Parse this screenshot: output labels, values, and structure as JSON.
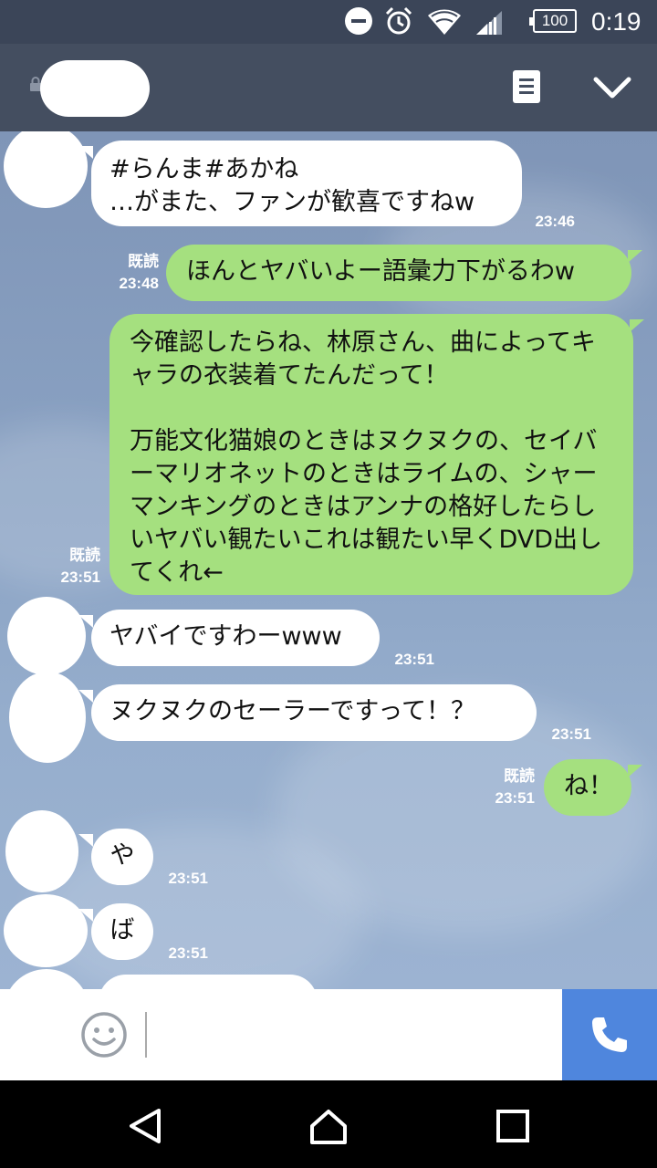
{
  "status_bar": {
    "battery": "100",
    "time": "0:19",
    "icons": [
      "do-not-disturb-icon",
      "alarm-icon",
      "wifi-icon",
      "signal-icon",
      "battery-icon"
    ]
  },
  "header": {
    "icons": [
      "lock-icon",
      "menu-icon",
      "chevron-down-icon"
    ]
  },
  "messages": [
    {
      "type": "received",
      "text": "#らんま#あかね\n…がまた、ファンが歓喜ですねw",
      "time": "23:46"
    },
    {
      "type": "sent",
      "read": "既読",
      "text": "ほんとヤバいよー語彙力下がるわw",
      "time": "23:48"
    },
    {
      "type": "sent",
      "read": "既読",
      "text": "今確認したらね、林原さん、曲によってキャラの衣装着てたんだって！\n\n万能文化猫娘のときはヌクヌクの、セイバーマリオネットのときはライムの、シャーマンキングのときはアンナの格好したらしいヤバい観たいこれは観たい早くDVD出してくれ←",
      "time": "23:51"
    },
    {
      "type": "received",
      "text": "ヤバイですわーwww",
      "time": "23:51"
    },
    {
      "type": "received",
      "text": "ヌクヌクのセーラーですって！？",
      "time": "23:51"
    },
    {
      "type": "sent",
      "read": "既読",
      "text": "ね！",
      "time": "23:51"
    },
    {
      "type": "received",
      "text": "や",
      "time": "23:51"
    },
    {
      "type": "received",
      "text": "ば",
      "time": "23:51"
    }
  ],
  "input_bar": {
    "icons": [
      "emoji-icon",
      "phone-icon"
    ]
  },
  "nav_bar": {
    "icons": [
      "back-icon",
      "home-icon",
      "recents-icon"
    ]
  },
  "colors": {
    "header": "#444e60",
    "status_bar": "#3b4558",
    "sent_bubble": "#a5e07f",
    "received_bubble": "#ffffff",
    "call_button": "#4f86dd"
  }
}
